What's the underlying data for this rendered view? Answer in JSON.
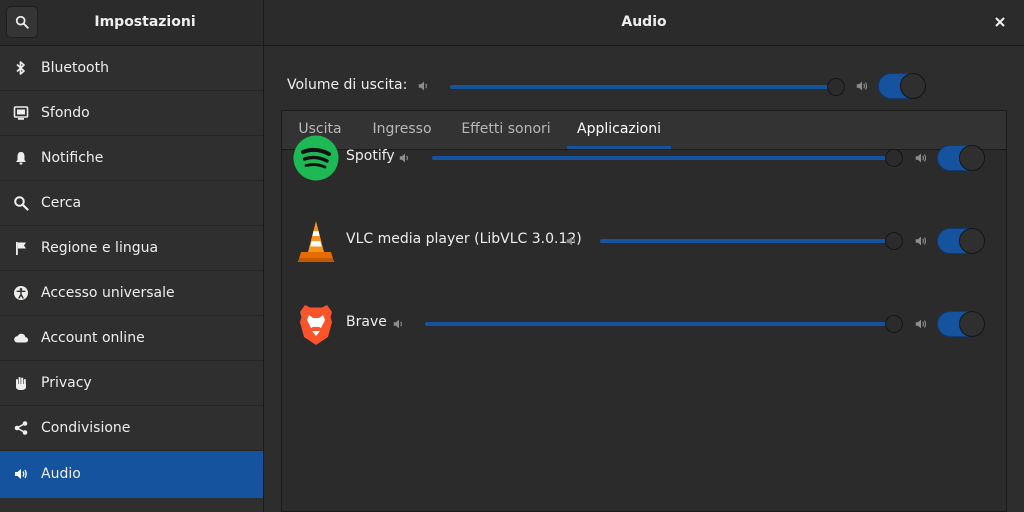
{
  "header": {
    "settings_title": "Impostazioni",
    "page_title": "Audio"
  },
  "sidebar": {
    "items": [
      {
        "label": "Bluetooth",
        "icon": "bluetooth-icon"
      },
      {
        "label": "Sfondo",
        "icon": "background-icon"
      },
      {
        "label": "Notifiche",
        "icon": "bell-icon"
      },
      {
        "label": "Cerca",
        "icon": "search-icon"
      },
      {
        "label": "Regione e lingua",
        "icon": "flag-icon"
      },
      {
        "label": "Accesso universale",
        "icon": "accessibility-icon"
      },
      {
        "label": "Account online",
        "icon": "cloud-icon"
      },
      {
        "label": "Privacy",
        "icon": "hand-icon"
      },
      {
        "label": "Condivisione",
        "icon": "share-icon"
      },
      {
        "label": "Audio",
        "icon": "speaker-icon",
        "active": true
      }
    ]
  },
  "output": {
    "label": "Volume di uscita:",
    "volume_fraction": 1.0,
    "enabled": true
  },
  "tabs": [
    {
      "label": "Uscita"
    },
    {
      "label": "Ingresso"
    },
    {
      "label": "Effetti sonori"
    },
    {
      "label": "Applicazioni",
      "active": true
    }
  ],
  "apps": [
    {
      "name": "Spotify",
      "icon": "spotify-icon",
      "volume_fraction": 1.0,
      "enabled": true
    },
    {
      "name": "VLC media player (LibVLC 3.0.12)",
      "icon": "vlc-icon",
      "volume_fraction": 1.0,
      "enabled": true
    },
    {
      "name": "Brave",
      "icon": "brave-icon",
      "volume_fraction": 1.0,
      "enabled": true
    }
  ],
  "colors": {
    "accent": "#15539e",
    "background": "#2d2d2d",
    "sidebar": "#2f2f2f",
    "spotify": "#1db954",
    "vlc": "#f28a00",
    "brave": "#fb542b"
  }
}
